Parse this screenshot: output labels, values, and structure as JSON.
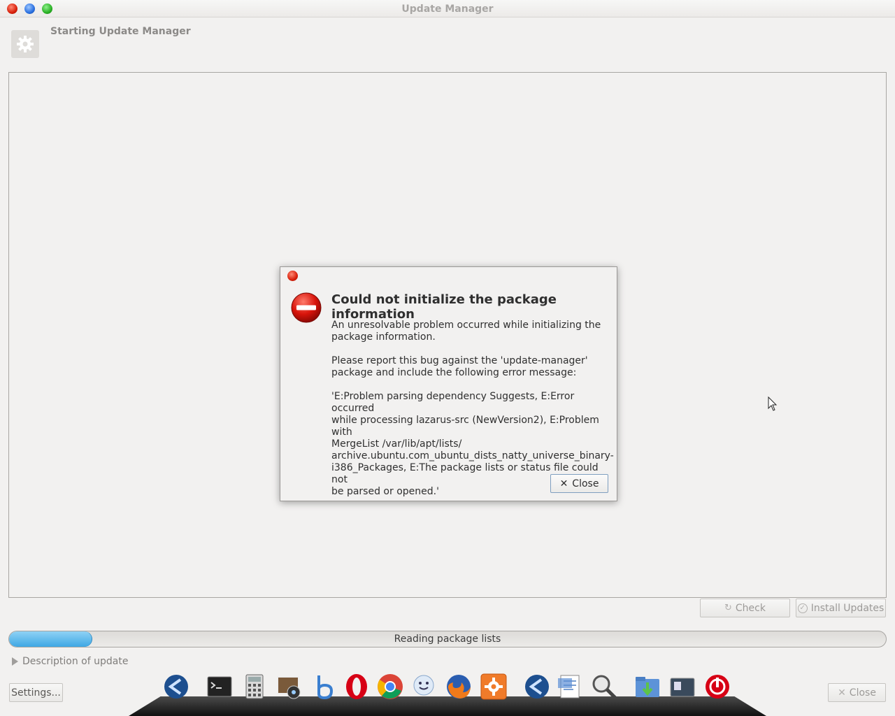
{
  "window": {
    "title": "Update Manager"
  },
  "header": {
    "title": "Starting Update Manager",
    "icon": "gear-icon"
  },
  "buttons": {
    "check": "Check",
    "install": "Install Updates",
    "settings": "Settings...",
    "close": "Close"
  },
  "progress": {
    "label": "Reading package lists",
    "fraction": 0.095
  },
  "expander": {
    "label": "Description of update"
  },
  "dialog": {
    "heading": "Could not initialize the package information",
    "paragraph1": "An unresolvable problem occurred while initializing the\npackage information.",
    "paragraph2": "Please report this bug against the 'update-manager'\npackage and include the following error message:",
    "paragraph3": "'E:Problem parsing dependency Suggests, E:Error occurred\nwhile processing lazarus-src (NewVersion2), E:Problem with\nMergeList /var/lib/apt/lists/\narchive.ubuntu.com_ubuntu_dists_natty_universe_binary-\ni386_Packages, E:The package lists or status file could not\nbe parsed or opened.'",
    "close_button": "Close"
  },
  "dock": {
    "items": [
      "eclipse-icon",
      "terminal-icon",
      "calculator-icon",
      "photos-icon",
      "bluefish-icon",
      "opera-icon",
      "chrome-icon",
      "messenger-icon",
      "firefox-icon",
      "update-manager-icon",
      "eclipse-icon",
      "text-editor-icon",
      "search-icon",
      "downloads-folder-icon",
      "screenshot-icon",
      "power-icon"
    ]
  }
}
